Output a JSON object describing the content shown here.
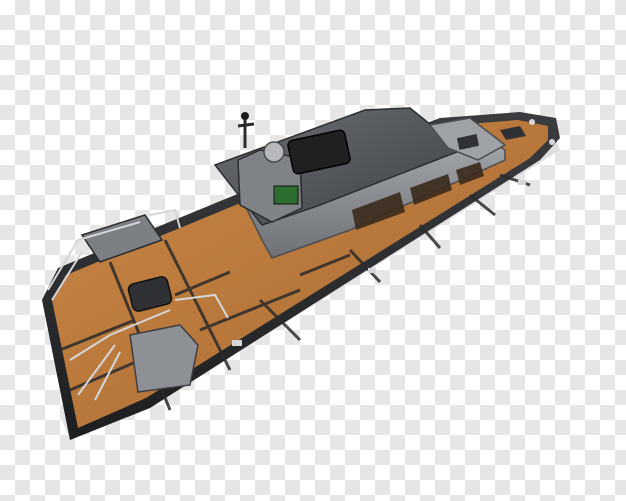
{
  "image": {
    "background": "transparency-checkerboard",
    "subject": "boat-render",
    "colors": {
      "checker_light": "#ffffff",
      "checker_dark": "#e6e6e6",
      "hull_dark": "#2f3133",
      "deck_wood": "#b9773f",
      "deck_wood_light": "#cf8a4c",
      "cabin_grey": "#8c8f93",
      "cabin_roof": "#55585c",
      "rail_silver": "#c9ccd0"
    }
  }
}
